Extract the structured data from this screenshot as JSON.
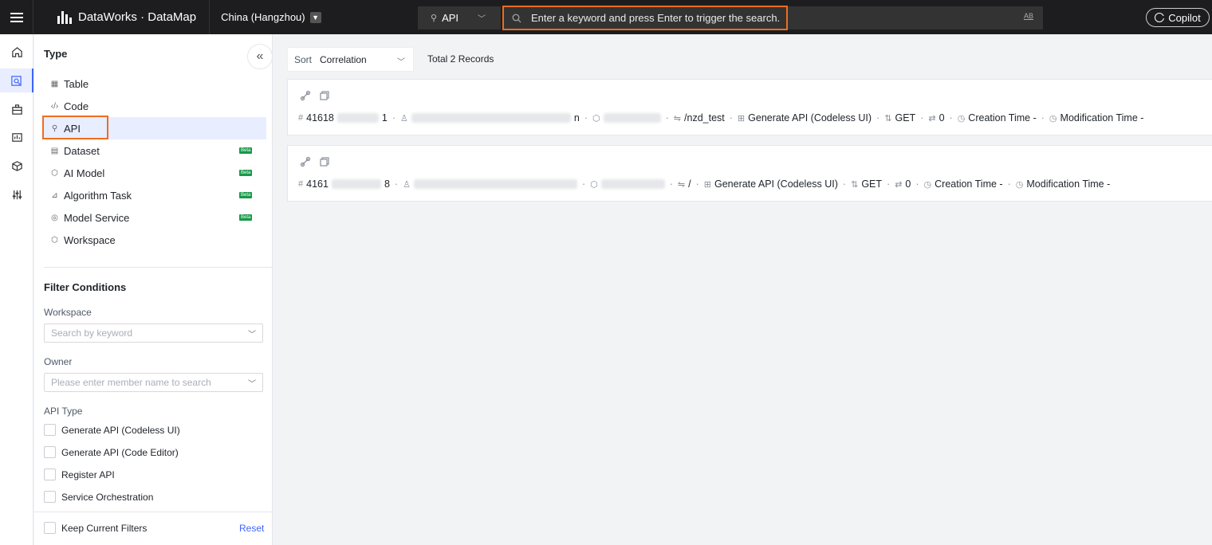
{
  "topbar": {
    "brand": "DataWorks · DataMap",
    "region": "China (Hangzhou)",
    "search_type": "API",
    "search_placeholder": "Enter a keyword and press Enter to trigger the search.",
    "case_toggle": "AB",
    "copilot": "Copilot"
  },
  "rail": {
    "items": [
      "home-icon",
      "search-map-icon",
      "briefcase-icon",
      "dashboard-icon",
      "cube-icon",
      "sliders-icon"
    ]
  },
  "type_panel": {
    "title": "Type",
    "items": [
      {
        "label": "Table",
        "icon": "table-icon"
      },
      {
        "label": "Code",
        "icon": "code-icon"
      },
      {
        "label": "API",
        "icon": "api-link-icon",
        "active": true
      },
      {
        "label": "Dataset",
        "icon": "dataset-icon",
        "badge": "Beta"
      },
      {
        "label": "AI Model",
        "icon": "ai-model-icon",
        "badge": "Beta"
      },
      {
        "label": "Algorithm Task",
        "icon": "algorithm-icon",
        "badge": "Beta"
      },
      {
        "label": "Model Service",
        "icon": "model-service-icon",
        "badge": "Beta"
      },
      {
        "label": "Workspace",
        "icon": "workspace-icon"
      }
    ]
  },
  "filters": {
    "title": "Filter Conditions",
    "workspace_label": "Workspace",
    "workspace_placeholder": "Search by keyword",
    "owner_label": "Owner",
    "owner_placeholder": "Please enter member name to search",
    "api_type_label": "API Type",
    "api_types": [
      "Generate API (Codeless UI)",
      "Generate API (Code Editor)",
      "Register API",
      "Service Orchestration"
    ],
    "keep_filters": "Keep Current Filters",
    "reset": "Reset"
  },
  "results": {
    "sort_label": "Sort",
    "sort_value": "Correlation",
    "total": "Total 2 Records",
    "records": [
      {
        "id_prefix": "41618",
        "id_suffix": "1",
        "owner_suffix": "n",
        "path": "/nzd_test",
        "api_type": "Generate API (Codeless UI)",
        "method": "GET",
        "count": "0",
        "creation": "Creation Time -",
        "modification": "Modification Time -"
      },
      {
        "id_prefix": "4161",
        "id_suffix": "8",
        "owner_suffix": "",
        "path": "/",
        "api_type": "Generate API (Codeless UI)",
        "method": "GET",
        "count": "0",
        "creation": "Creation Time -",
        "modification": "Modification Time -"
      }
    ]
  },
  "colors": {
    "topbar_bg": "#1d1d1f",
    "highlight_orange": "#ed6d1f",
    "active_bg": "#e8edff",
    "accent_blue": "#3d64ff",
    "beta_green": "#169a48"
  }
}
